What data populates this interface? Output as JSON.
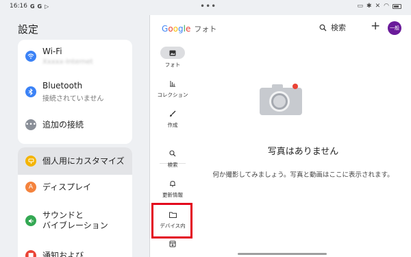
{
  "status": {
    "time": "16:16",
    "small_icons": [
      "G",
      "G",
      "▷"
    ]
  },
  "settings": {
    "title": "設定",
    "items": [
      {
        "label": "Wi-Fi",
        "sub": "Xxxxx-Internet",
        "icon": "wifi-icon",
        "color": "#3b82f6"
      },
      {
        "label": "Bluetooth",
        "sub": "接続されていません",
        "icon": "bluetooth-icon",
        "color": "#3b82f6"
      },
      {
        "label": "追加の接続",
        "sub": "",
        "icon": "more-icon",
        "color": "#8a8f98"
      },
      {
        "label": "個人用にカスタマイズ",
        "sub": "",
        "icon": "customize-icon",
        "color": "#f4b400"
      },
      {
        "label": "ディスプレイ",
        "sub": "",
        "icon": "display-icon",
        "color": "#f4833d"
      },
      {
        "label": "サウンドと",
        "label2": "バイブレーション",
        "sub": "",
        "icon": "sound-icon",
        "color": "#34a853"
      },
      {
        "label": "通知および",
        "sub": "",
        "icon": "notification-icon",
        "color": "#ea4335"
      }
    ]
  },
  "app": {
    "logo": "Google",
    "product": "フォト",
    "search_label": "検索",
    "avatar_label": "一般",
    "nav": [
      {
        "label": "フォト",
        "icon": "photo-icon"
      },
      {
        "label": "コレクション",
        "icon": "collection-icon"
      },
      {
        "label": "作成",
        "icon": "brush-icon"
      },
      {
        "label": "検索",
        "icon": "search-icon"
      },
      {
        "label": "更新情報",
        "icon": "bell-icon"
      },
      {
        "label": "デバイス内",
        "icon": "folder-icon"
      },
      {
        "label": "",
        "icon": "archive-icon"
      }
    ],
    "empty": {
      "title": "写真はありません",
      "description": "何か撮影してみましょう。写真と動画はここに表示されます。"
    }
  },
  "colors": {
    "highlight": "#e3001b",
    "camera_body": "#c7cacf",
    "camera_red": "#ea4335"
  }
}
